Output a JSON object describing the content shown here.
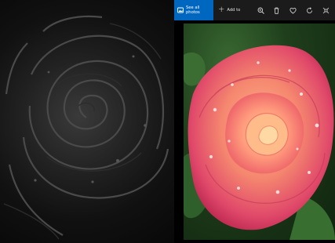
{
  "toolbar": {
    "see_all_label": "See all photos",
    "add_to_label": "Add to",
    "accent": "#0067c0",
    "icons": [
      "zoom-icon",
      "delete-icon",
      "favorite-icon",
      "rotate-icon",
      "edit-icon"
    ]
  },
  "left_image": {
    "description_icon": "grayscale-edge-rose"
  },
  "right_image": {
    "description_icon": "pink-rose-with-water-droplets"
  }
}
